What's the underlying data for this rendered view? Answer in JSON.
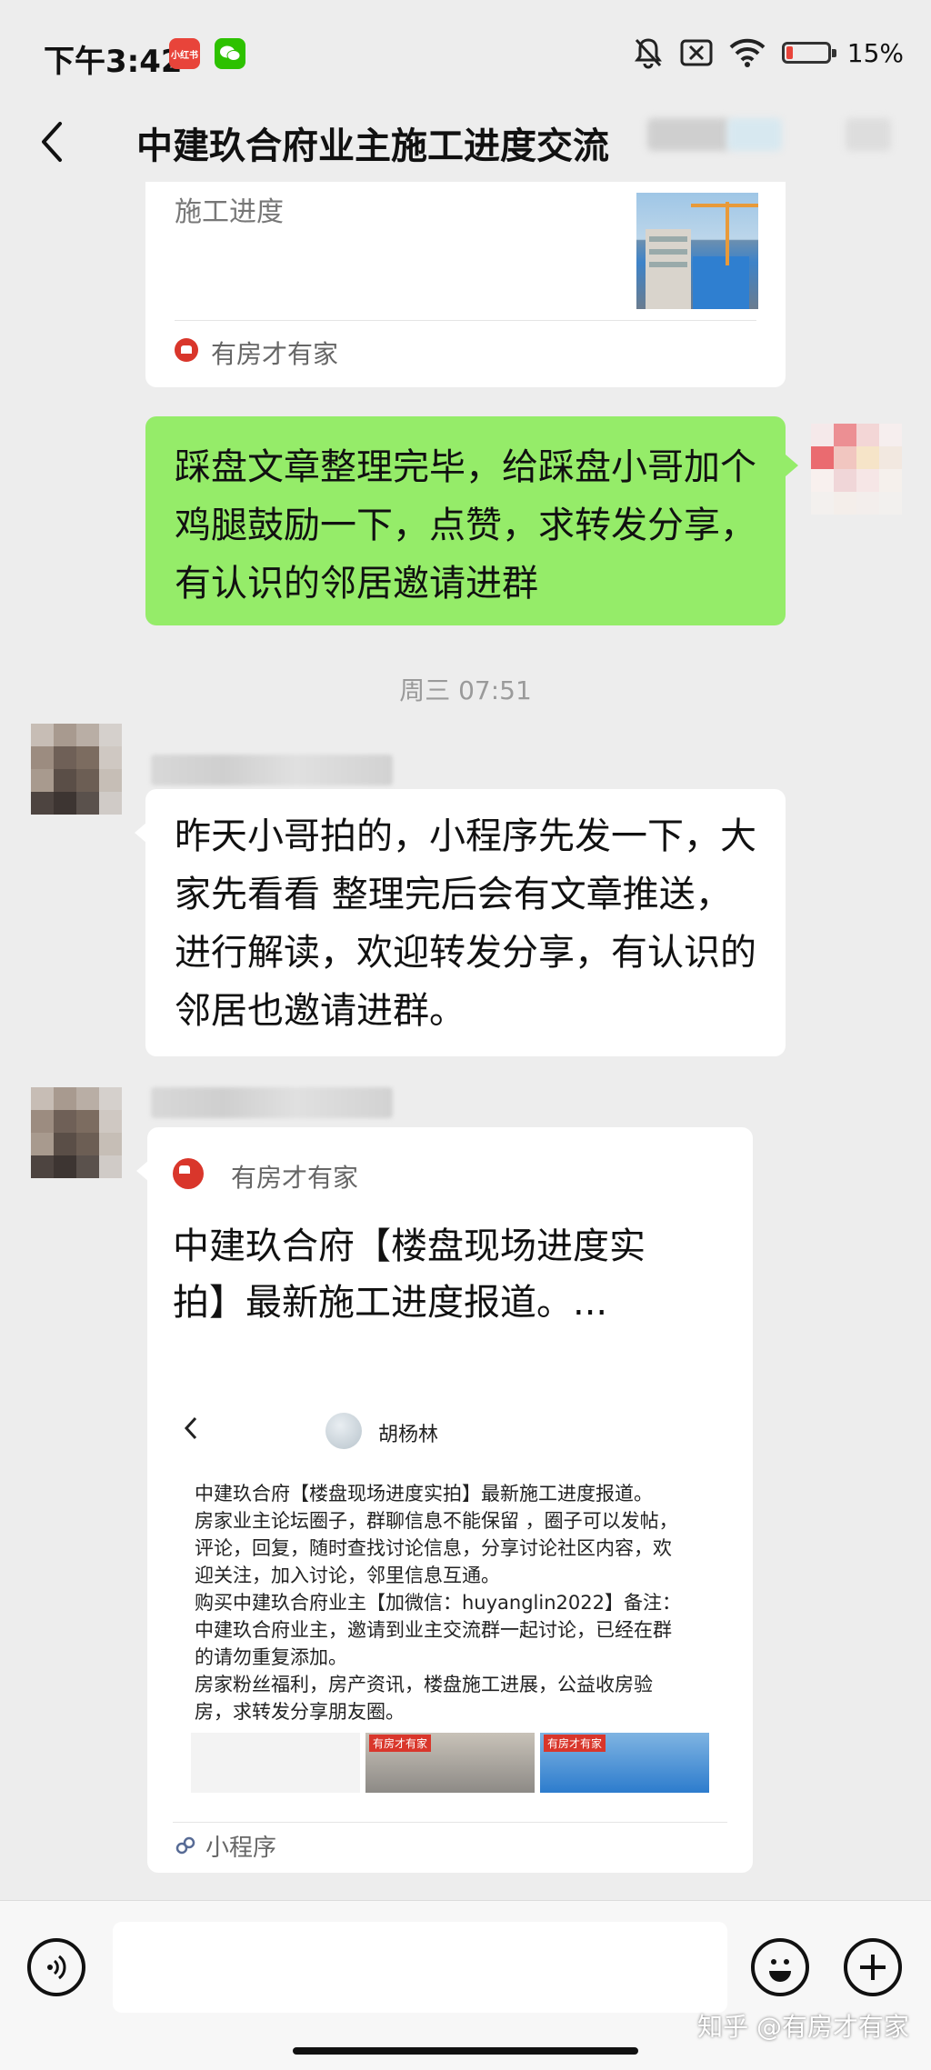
{
  "status_bar": {
    "time": "下午3:42",
    "badge_app": "小红书",
    "battery_percent": "15%",
    "battery_level": 0.15,
    "icons": [
      "mute-bell-icon",
      "close-box-icon",
      "wifi-icon",
      "battery-icon"
    ]
  },
  "header": {
    "title": "中建玖合府业主施工进度交流"
  },
  "messages": {
    "card_top": {
      "text": "施工进度",
      "source": "有房才有家"
    },
    "outgoing_1": {
      "text": "踩盘文章整理完毕，给踩盘小哥加个鸡腿鼓励一下，点赞，求转发分享，有认识的邻居邀请进群"
    },
    "timestamp": "周三 07:51",
    "incoming_1": {
      "text": "昨天小哥拍的，小程序先发一下，大家先看看 整理完后会有文章推送，进行解读，欢迎转发分享，有认识的邻居也邀请进群。"
    },
    "mini_program": {
      "source": "有房才有家",
      "title": "中建玖合府【楼盘现场进度实拍】最新施工进度报道。...",
      "preview_author": "胡杨林",
      "preview_lines": [
        "中建玖合府【楼盘现场进度实拍】最新施工进度报道。",
        "房家业主论坛圈子，群聊信息不能保留 ，圈子可以发帖，",
        "评论，回复，随时查找讨论信息，分享讨论社区内容，欢",
        "迎关注，加入讨论，邻里信息互通。",
        "购买中建玖合府业主【加微信：huyanglin2022】备注：",
        "中建玖合府业主，邀请到业主交流群一起讨论，已经在群",
        "的请勿重复添加。",
        "房家粉丝福利，房产资讯，楼盘施工进展，公益收房验",
        "房，求转发分享朋友圈。"
      ],
      "thumb_labels": [
        "有房才有家",
        "有房才有家"
      ],
      "footer": "小程序"
    }
  },
  "input_bar": {
    "placeholder": "",
    "voice": "voice-icon",
    "emoji": "emoji-icon",
    "plus": "plus-icon"
  },
  "watermark": "知乎 @有房才有家",
  "colors": {
    "background": "#ededed",
    "bubble_outgoing": "#95ec69",
    "bubble_incoming": "#ffffff",
    "accent_red": "#e8443a"
  }
}
